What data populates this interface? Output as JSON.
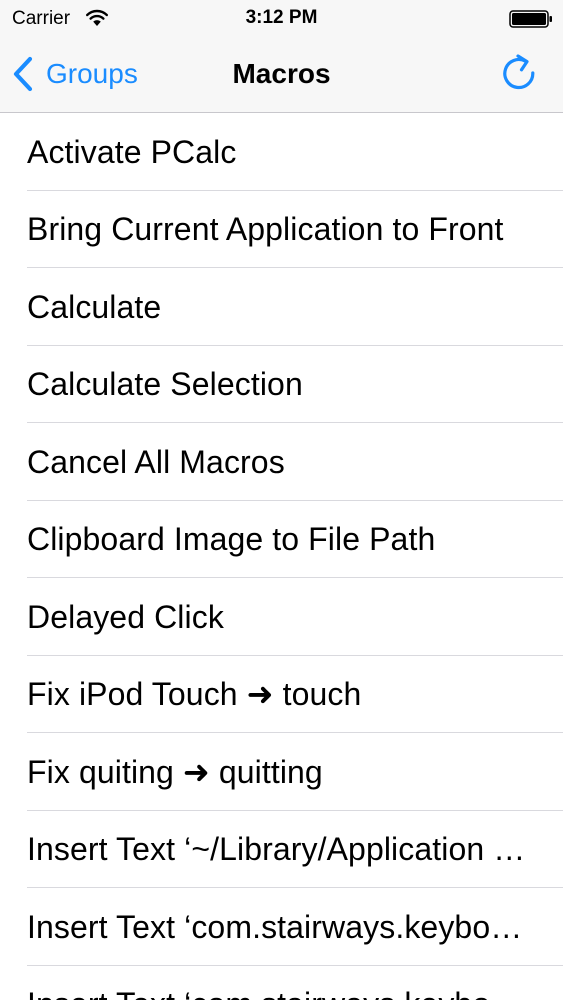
{
  "status_bar": {
    "carrier": "Carrier",
    "time": "3:12 PM",
    "icons": {
      "wifi": "wifi-icon",
      "battery": "battery-icon"
    }
  },
  "nav_bar": {
    "back_label": "Groups",
    "title": "Macros",
    "back_icon": "chevron-left-icon",
    "refresh_icon": "refresh-icon",
    "accent_color": "#1a8cff"
  },
  "macros": [
    {
      "label": "Activate PCalc"
    },
    {
      "label": "Bring Current Application to Front"
    },
    {
      "label": "Calculate"
    },
    {
      "label": "Calculate Selection"
    },
    {
      "label": "Cancel All Macros"
    },
    {
      "label": "Clipboard Image to File Path"
    },
    {
      "label": "Delayed Click"
    },
    {
      "label": "Fix iPod Touch ➜ touch"
    },
    {
      "label": "Fix quiting ➜ quitting"
    },
    {
      "label": "Insert Text ‘~/Library/Application Support’"
    },
    {
      "label": "Insert Text ‘com.stairways.keyboardmaestro’"
    },
    {
      "label": "Insert Text ‘com.stairways.keyboardmaestro.engine’"
    }
  ]
}
